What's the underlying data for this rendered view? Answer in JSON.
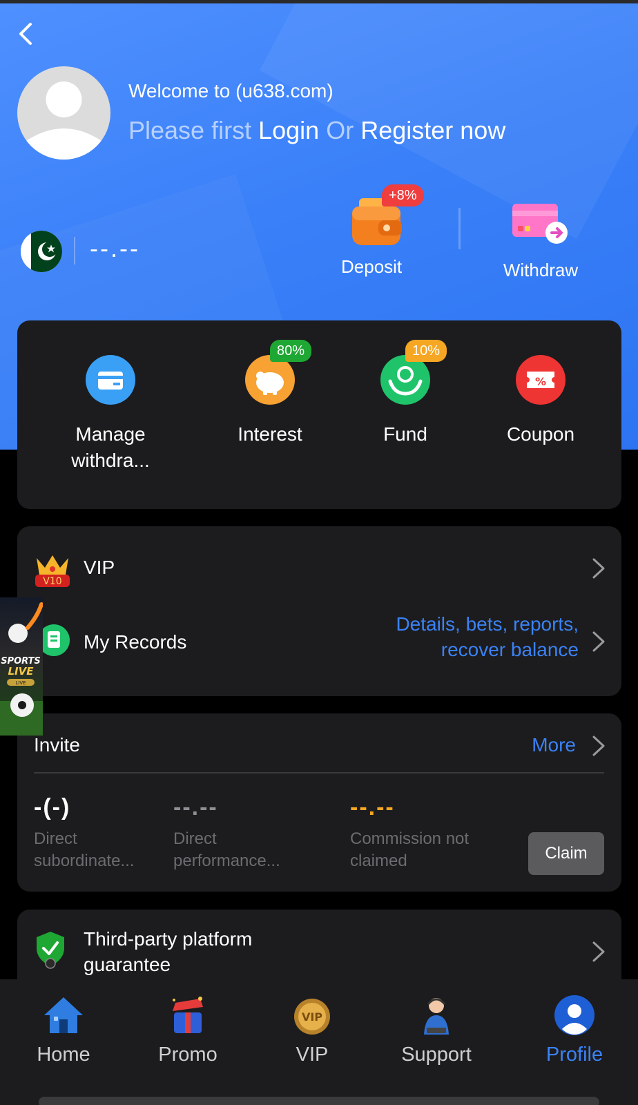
{
  "header": {
    "welcome_text": "Welcome to (u638.com)",
    "please_first": "Please first",
    "login_link": "Login",
    "or_text": "Or",
    "register_link": "Register now"
  },
  "wallet": {
    "balance": "--.--",
    "deposit_label": "Deposit",
    "deposit_badge": "+8%",
    "withdraw_label": "Withdraw"
  },
  "quick_actions": [
    {
      "label": "Manage withdra...",
      "badge": "",
      "color": "#3aa0f5"
    },
    {
      "label": "Interest",
      "badge": "80%",
      "color": "#f7a233"
    },
    {
      "label": "Fund",
      "badge": "10%",
      "color": "#1fc46a"
    },
    {
      "label": "Coupon",
      "badge": "",
      "color": "#ef3434"
    }
  ],
  "menu": {
    "vip_label": "VIP",
    "vip_level": "V10",
    "records_label": "My Records",
    "records_note": "Details, bets, reports, recover balance"
  },
  "invite": {
    "title": "Invite",
    "more_label": "More",
    "stats": [
      {
        "value": "-(-)",
        "label": "Direct subordinate..."
      },
      {
        "value": "--.--",
        "label": "Direct performance..."
      },
      {
        "value": "--.--",
        "label": "Commission not claimed"
      }
    ],
    "claim_label": "Claim"
  },
  "third_party": {
    "label": "Third-party platform guarantee"
  },
  "ad": {
    "line1": "SPORTS",
    "line2": "LIVE",
    "badge": "LIVE"
  },
  "tabs": [
    {
      "label": "Home",
      "active": false
    },
    {
      "label": "Promo",
      "active": false
    },
    {
      "label": "VIP",
      "active": false
    },
    {
      "label": "Support",
      "active": false
    },
    {
      "label": "Profile",
      "active": true
    }
  ],
  "colors": {
    "accent_blue": "#3b82f6",
    "hero_blue": "#3a80f8",
    "card_bg": "#1c1c1e",
    "commission_orange": "#f5a623"
  }
}
